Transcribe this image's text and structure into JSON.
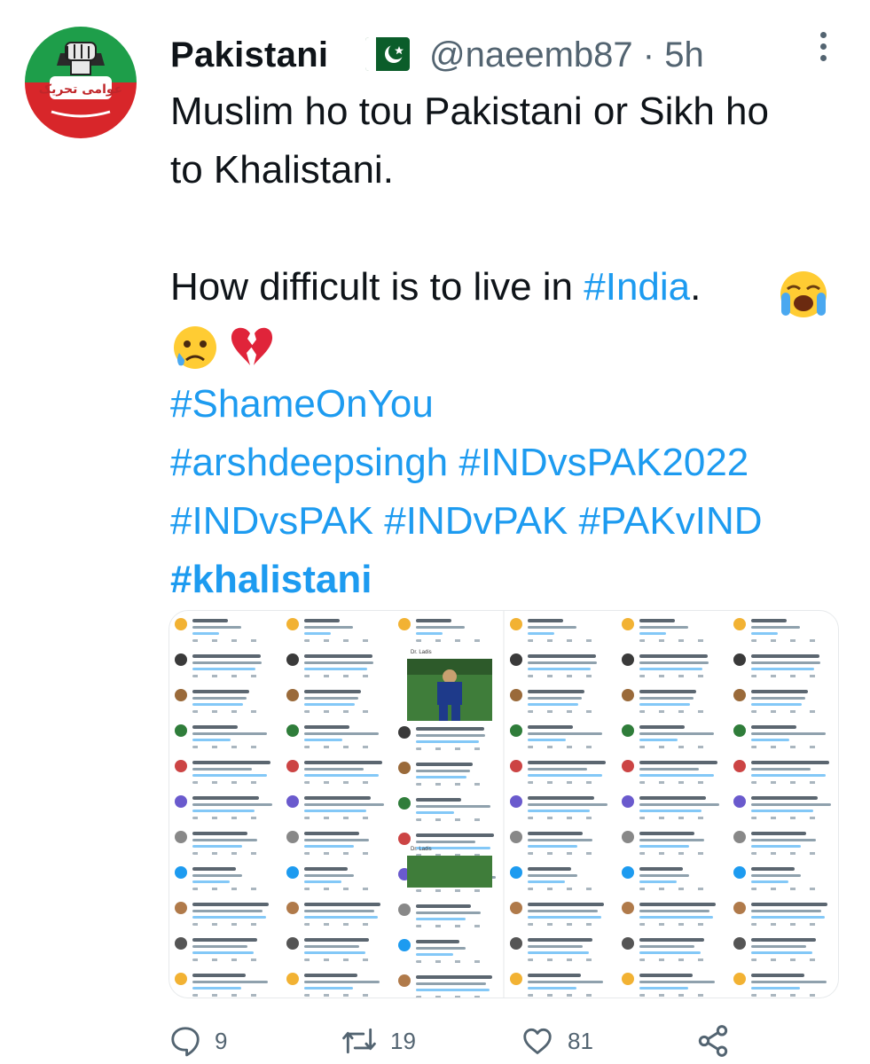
{
  "tweet": {
    "display_name": "Pakistani",
    "handle": "@naeemb87",
    "separator": "·",
    "time": "5h",
    "text_line1": "Muslim ho tou Pakistani or Sikh ho",
    "text_line2": "to Khalistani.",
    "text_line3_prefix": "How difficult is to live in ",
    "text_line3_tag": "#India",
    "text_line3_suffix": ".",
    "hashtags_line1": "#ShameOnYou",
    "hashtags_line2": "#arshdeepsingh #INDvsPAK2022",
    "hashtags_line3": "#INDvsPAK #INDvPAK #PAKvIND",
    "hashtags_line4": "#khalistani",
    "emojis": [
      "loudly-crying-face",
      "sad-but-relieved-face",
      "broken-heart"
    ],
    "flag": "pakistan-flag",
    "avatar_logo_text": "عوامی تحریک"
  },
  "media": {
    "panel_captions": [
      "Dr. Ladis",
      "Dr. Ladis"
    ]
  },
  "actions": {
    "replies": "9",
    "retweets": "19",
    "likes": "81"
  },
  "colors": {
    "link": "#1d9bf0",
    "secondary": "#536471",
    "text": "#0f1419",
    "avatar_green": "#1e9e4a",
    "avatar_red": "#d8262a"
  }
}
